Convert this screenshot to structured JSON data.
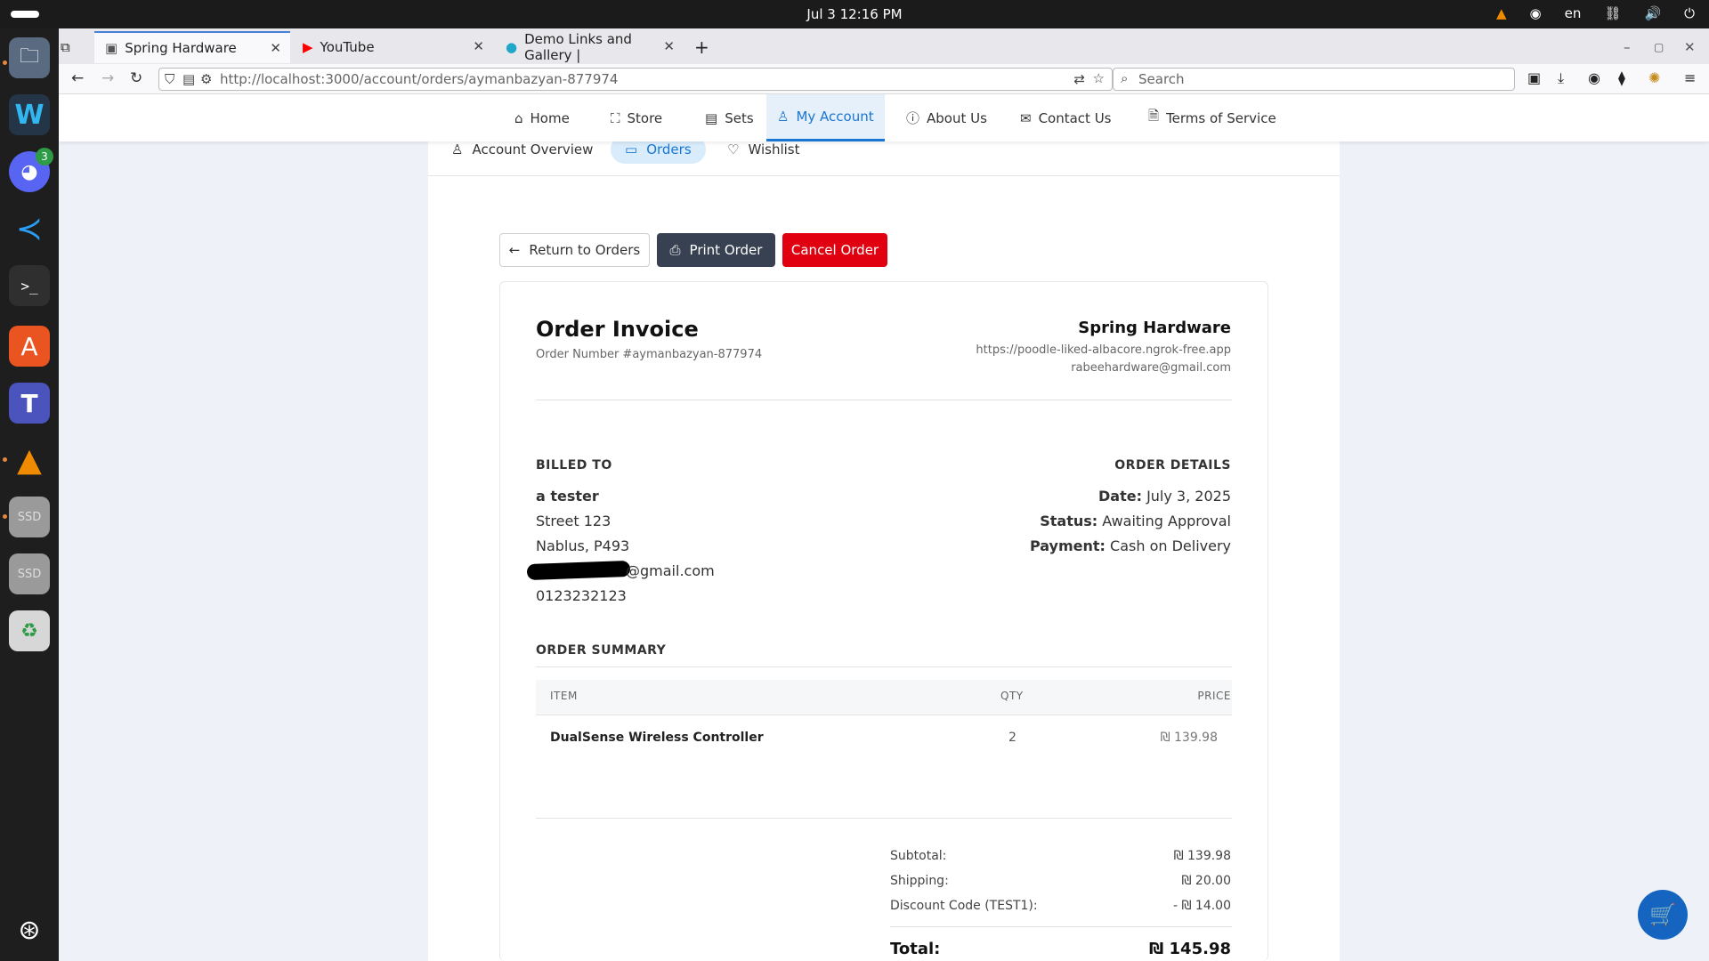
{
  "system": {
    "clock": "Jul 3  12:16 PM",
    "lang": "en",
    "discord_badge": "3"
  },
  "browser": {
    "tabs": [
      {
        "title": "Spring Hardware"
      },
      {
        "title": "YouTube"
      },
      {
        "title": "Demo Links and Gallery |"
      }
    ],
    "url": "http://localhost:3000/account/orders/aymanbazyan-877974",
    "search_placeholder": "Search"
  },
  "nav": {
    "items": [
      {
        "label": "Home"
      },
      {
        "label": "Store"
      },
      {
        "label": "Sets"
      },
      {
        "label": "My Account"
      },
      {
        "label": "About Us"
      },
      {
        "label": "Contact Us"
      },
      {
        "label": "Terms of Service"
      }
    ]
  },
  "account_tabs": {
    "overview": "Account Overview",
    "orders": "Orders",
    "wishlist": "Wishlist"
  },
  "actions": {
    "return": "Return to Orders",
    "print": "Print Order",
    "cancel": "Cancel Order"
  },
  "invoice": {
    "title": "Order Invoice",
    "order_number": "Order Number #aymanbazyan-877974",
    "store_name": "Spring Hardware",
    "store_url": "https://poodle-liked-albacore.ngrok-free.app",
    "store_email": "rabeehardware@gmail.com",
    "billed_to_heading": "BILLED TO",
    "billed": {
      "name": "a tester",
      "street": "Street 123",
      "city": "Nablus, P493",
      "email_suffix": "@gmail.com",
      "phone": "0123232123"
    },
    "details_heading": "ORDER DETAILS",
    "details": {
      "date_label": "Date:",
      "date": "July 3, 2025",
      "status_label": "Status:",
      "status": "Awaiting Approval",
      "payment_label": "Payment:",
      "payment": "Cash on Delivery"
    },
    "summary_heading": "ORDER SUMMARY",
    "columns": {
      "item": "ITEM",
      "qty": "QTY",
      "price": "PRICE"
    },
    "items": [
      {
        "name": "DualSense Wireless Controller",
        "qty": "2",
        "price": "₪ 139.98"
      }
    ],
    "totals": {
      "subtotal_label": "Subtotal:",
      "subtotal": "₪ 139.98",
      "shipping_label": "Shipping:",
      "shipping": "₪ 20.00",
      "discount_label": "Discount Code (TEST1):",
      "discount": "- ₪ 14.00",
      "total_label": "Total:",
      "total": "₪ 145.98"
    }
  },
  "colors": {
    "primary": "#1976d2",
    "dark_button": "#374151",
    "danger": "#e0000f",
    "cart_fab": "#1565c0"
  }
}
